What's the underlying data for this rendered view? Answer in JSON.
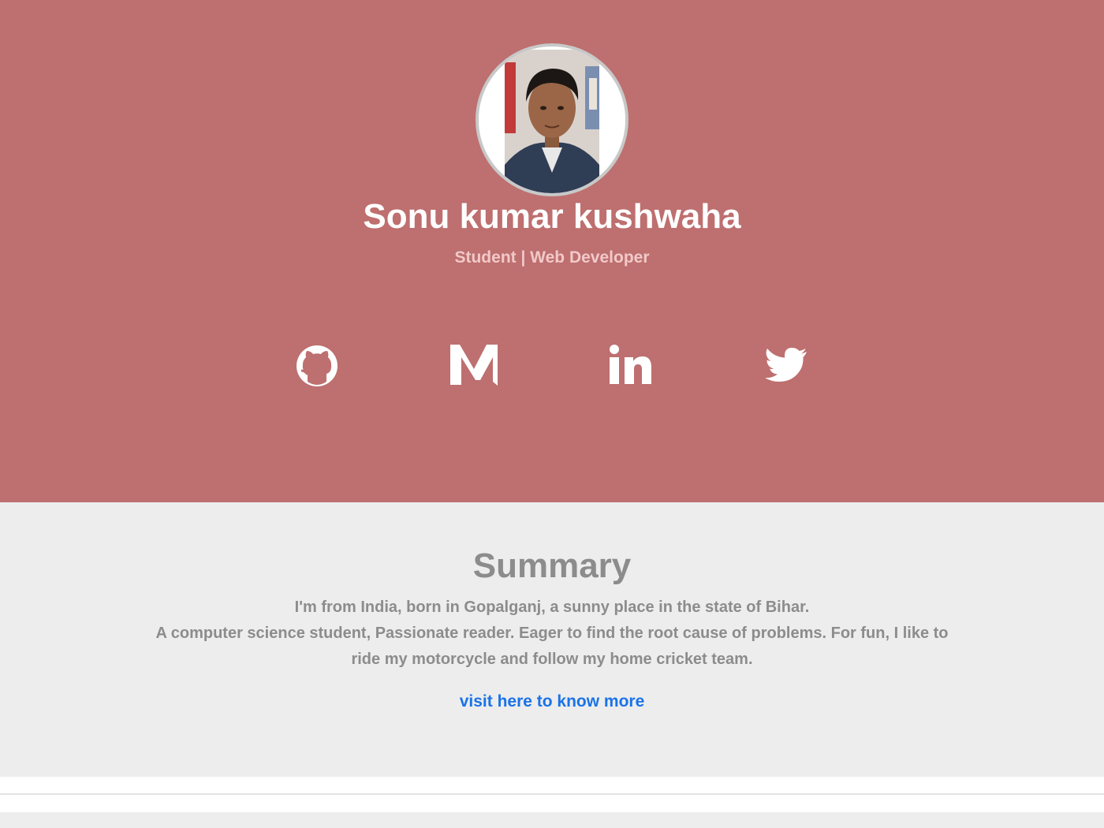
{
  "profile": {
    "name": "Sonu kumar kushwaha",
    "role": "Student | Web Developer"
  },
  "social": [
    {
      "icon": "github-icon"
    },
    {
      "icon": "medium-icon"
    },
    {
      "icon": "linkedin-icon"
    },
    {
      "icon": "twitter-icon"
    }
  ],
  "summary": {
    "title": "Summary",
    "line1": "I'm from India, born in Gopalganj, a sunny place in the state of Bihar.",
    "line2": "A computer science student, Passionate reader. Eager to find the root cause of problems. For fun, I like to ride my motorcycle and follow my home cricket team.",
    "link_text": "visit here to know more"
  },
  "colors": {
    "hero_bg": "#be6f6f",
    "page_bg": "#ededed",
    "link": "#1a73e8",
    "muted_text": "#8c8c8c"
  }
}
